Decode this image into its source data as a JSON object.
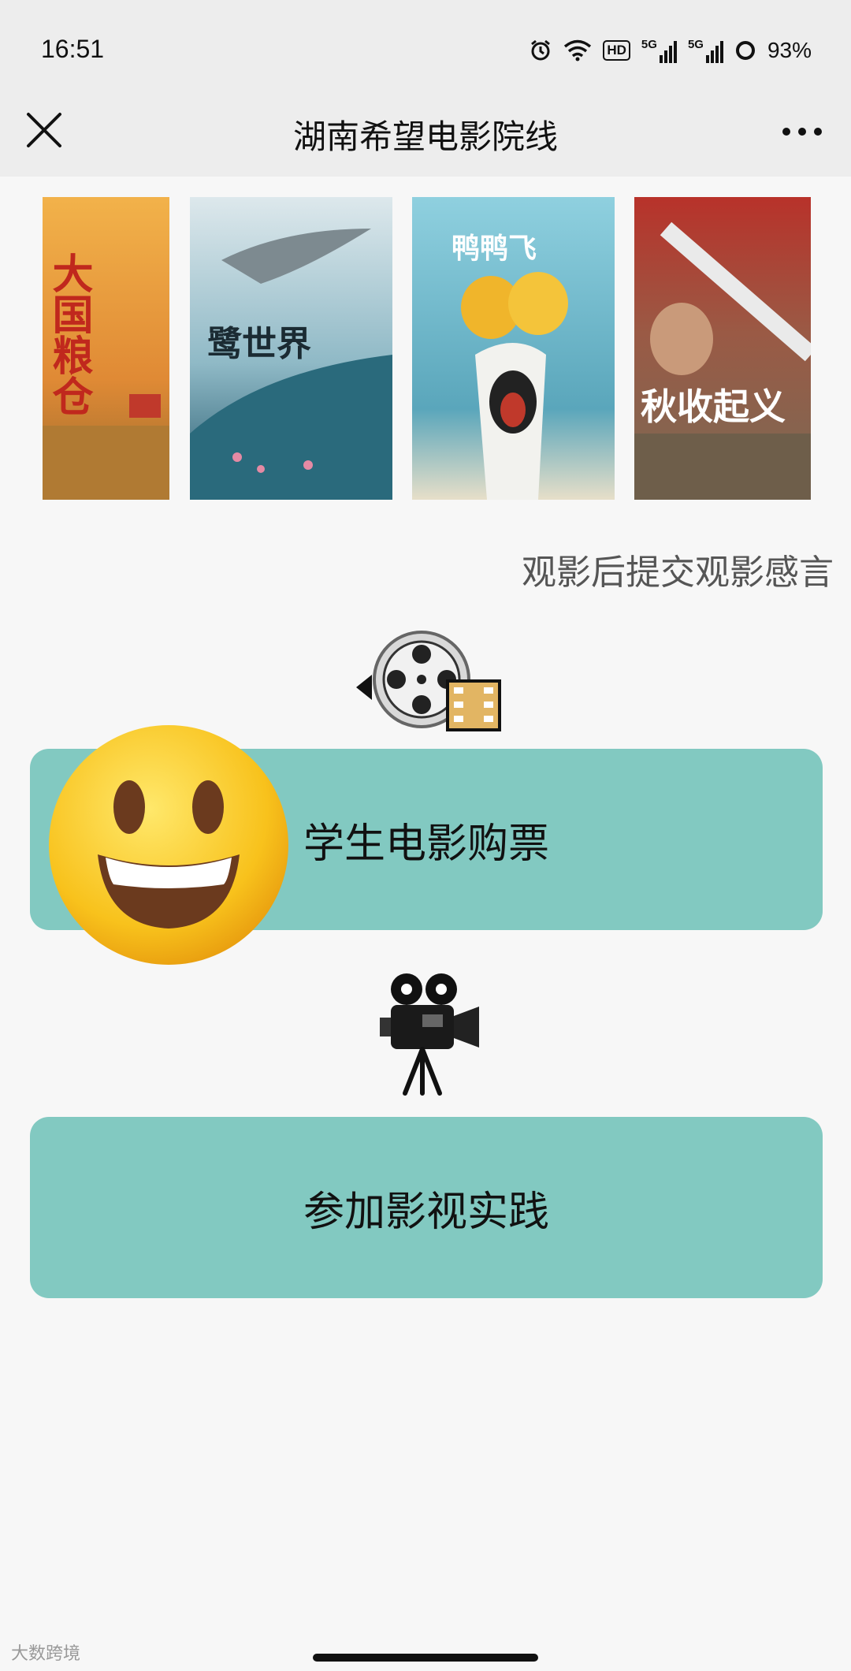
{
  "status_bar": {
    "time": "16:51",
    "hd_label": "HD",
    "net1": "5G",
    "net2": "5G",
    "battery_percent": "93%",
    "icons": [
      "alarm-icon",
      "wifi-icon",
      "hd-icon",
      "signal-5g-icon",
      "signal-5g-icon",
      "battery-ring-icon"
    ]
  },
  "nav": {
    "title": "湖南希望电影院线",
    "close_icon": "close-icon",
    "more_icon": "more-dots-icon"
  },
  "posters": [
    {
      "title": "大国粮仓",
      "colors": [
        "#e8a43a",
        "#c9622a"
      ]
    },
    {
      "title": "鹭世界",
      "colors": [
        "#dfe8ea",
        "#2f6e80"
      ]
    },
    {
      "title": "鸭鸭飞",
      "colors": [
        "#7fc7d6",
        "#3a8aa3"
      ]
    },
    {
      "title": "秋收起义",
      "colors": [
        "#c0392b",
        "#8a6f52"
      ]
    }
  ],
  "prompt": "观影后提交观影感言",
  "buttons": {
    "ticket": "学生电影购票",
    "practice": "参加影视实践"
  },
  "colors": {
    "button_bg": "#82c9c1",
    "page_bg": "#f7f7f7",
    "bar_bg": "#ededed"
  },
  "watermark": "大数跨境"
}
